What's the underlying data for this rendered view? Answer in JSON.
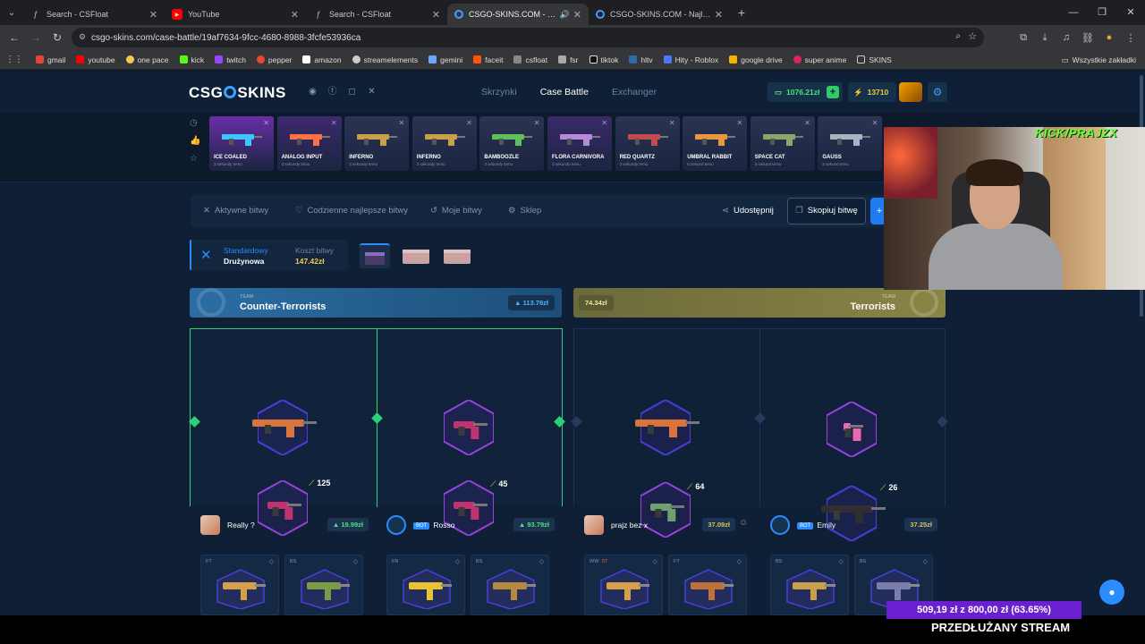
{
  "browser": {
    "tabs": [
      {
        "title": "Search - CSFloat",
        "active": false
      },
      {
        "title": "YouTube",
        "active": false
      },
      {
        "title": "Search - CSFloat",
        "active": false
      },
      {
        "title": "CSGO-SKINS.COM - Najlep",
        "active": true
      },
      {
        "title": "CSGO-SKINS.COM - Najlepsze",
        "active": false
      }
    ],
    "url": "csgo-skins.com/case-battle/19af7634-9fcc-4680-8988-3fcfe53936ca",
    "bookmarks": [
      "gmail",
      "youtube",
      "one pace",
      "kick",
      "twitch",
      "pepper",
      "amazon",
      "streamelements",
      "gemini",
      "faceit",
      "csfloat",
      "fsr",
      "tiktok",
      "hltv",
      "Hity - Roblox",
      "google drive",
      "super anime",
      "SKINS"
    ],
    "bookmarks_right": "Wszystkie zakładki"
  },
  "header": {
    "logo_left": "CSG",
    "logo_right": "SKINS",
    "nav": [
      "Skrzynki",
      "Case Battle",
      "Exchanger"
    ],
    "balance": "1076.21zł",
    "coins": "13710"
  },
  "drops": [
    {
      "name": "ICE COALED",
      "sub": "3 sekundy temu",
      "color": "#6a2ea8"
    },
    {
      "name": "ANALOG INPUT",
      "sub": "3 sekundy temu",
      "color": "#3d2a6e"
    },
    {
      "name": "INFERNO",
      "sub": "3 sekundy temu",
      "color": "#2b3454"
    },
    {
      "name": "INFERNO",
      "sub": "3 sekundy temu",
      "color": "#2b3454"
    },
    {
      "name": "BAMBOOZLE",
      "sub": "3 sekundy temu",
      "color": "#2b3454"
    },
    {
      "name": "FLORA CARNIVORA",
      "sub": "3 sekundy temu",
      "color": "#3a2a6a"
    },
    {
      "name": "RED QUARTZ",
      "sub": "3 sekundy temu",
      "color": "#2b3454"
    },
    {
      "name": "UMBRAL RABBIT",
      "sub": "5 sekund temu",
      "color": "#2b3454"
    },
    {
      "name": "SPACE CAT",
      "sub": "5 sekund temu",
      "color": "#2b3454"
    },
    {
      "name": "GAUSS",
      "sub": "5 sekund temu",
      "color": "#2b3454"
    }
  ],
  "subnav": {
    "items": [
      "Aktywne bitwy",
      "Codzienne najlepsze bitwy",
      "Moje bitwy",
      "Sklep"
    ],
    "share": "Udostępnij",
    "copy": "Skopiuj bitwę"
  },
  "mode": {
    "type_label": "Standardowy",
    "type_value": "Drużynowa",
    "cost_label": "Koszt bitwy",
    "cost_value": "147.42zł"
  },
  "teams": {
    "ct": {
      "label": "TEAM",
      "name": "Counter-Terrorists",
      "value": "113.78zł"
    },
    "t": {
      "label": "TEAM",
      "name": "Terrorists",
      "value": "74.34zł"
    }
  },
  "columns": [
    {
      "score": "125",
      "player": "Really ?",
      "value": "19.99zł",
      "bot": false,
      "conds": [
        "FT",
        "BS"
      ]
    },
    {
      "score": "45",
      "player": "Rosso",
      "value": "93.79zł",
      "bot": true,
      "conds": [
        "FN",
        "BS"
      ]
    },
    {
      "score": "64",
      "player": "prajz bez x",
      "value": "37.09zł",
      "bot": false,
      "conds": [
        "WW",
        "FT"
      ],
      "stattrak": "ST"
    },
    {
      "score": "26",
      "player": "Emily",
      "value": "37.25zł",
      "bot": true,
      "conds": [
        "BS",
        "BS"
      ]
    }
  ],
  "bot_label": "BOT",
  "overlay": {
    "kick": "KICK/PRAJZX",
    "donation": "509,19 zł z 800,00 zł (63.65%)",
    "stream": "PRZEDŁUŻANY STREAM"
  }
}
